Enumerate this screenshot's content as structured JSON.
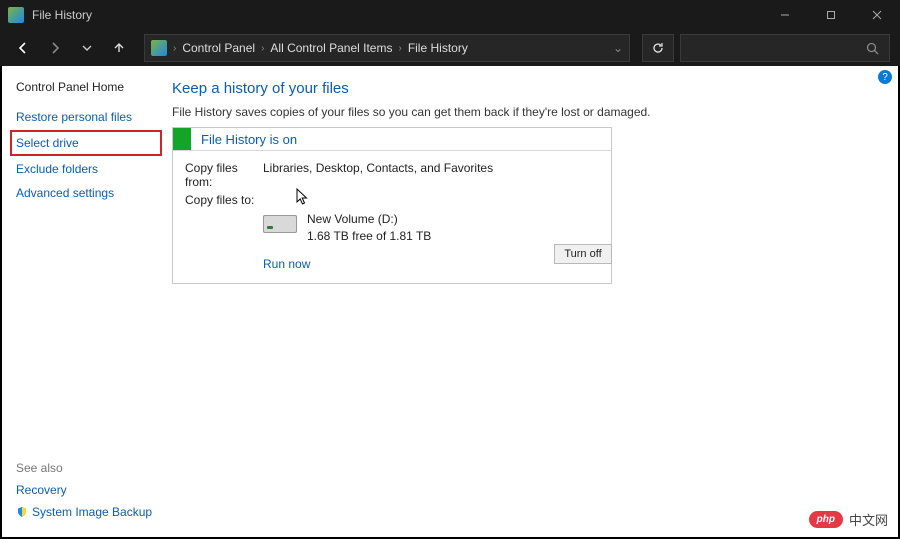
{
  "window": {
    "title": "File History"
  },
  "breadcrumb": [
    "Control Panel",
    "All Control Panel Items",
    "File History"
  ],
  "sidebar": {
    "home": "Control Panel Home",
    "links": [
      "Restore personal files",
      "Select drive",
      "Exclude folders",
      "Advanced settings"
    ],
    "see_also": "See also",
    "bottom": [
      "Recovery",
      "System Image Backup"
    ]
  },
  "main": {
    "heading": "Keep a history of your files",
    "description": "File History saves copies of your files so you can get them back if they're lost or damaged.",
    "status_title": "File History is on",
    "copy_from_label": "Copy files from:",
    "copy_from_value": "Libraries, Desktop, Contacts, and Favorites",
    "copy_to_label": "Copy files to:",
    "drive_name": "New Volume (D:)",
    "drive_free": "1.68 TB free of 1.81 TB",
    "run_now": "Run now",
    "turn_off": "Turn off"
  },
  "watermark": {
    "badge": "php",
    "text": "中文网"
  }
}
